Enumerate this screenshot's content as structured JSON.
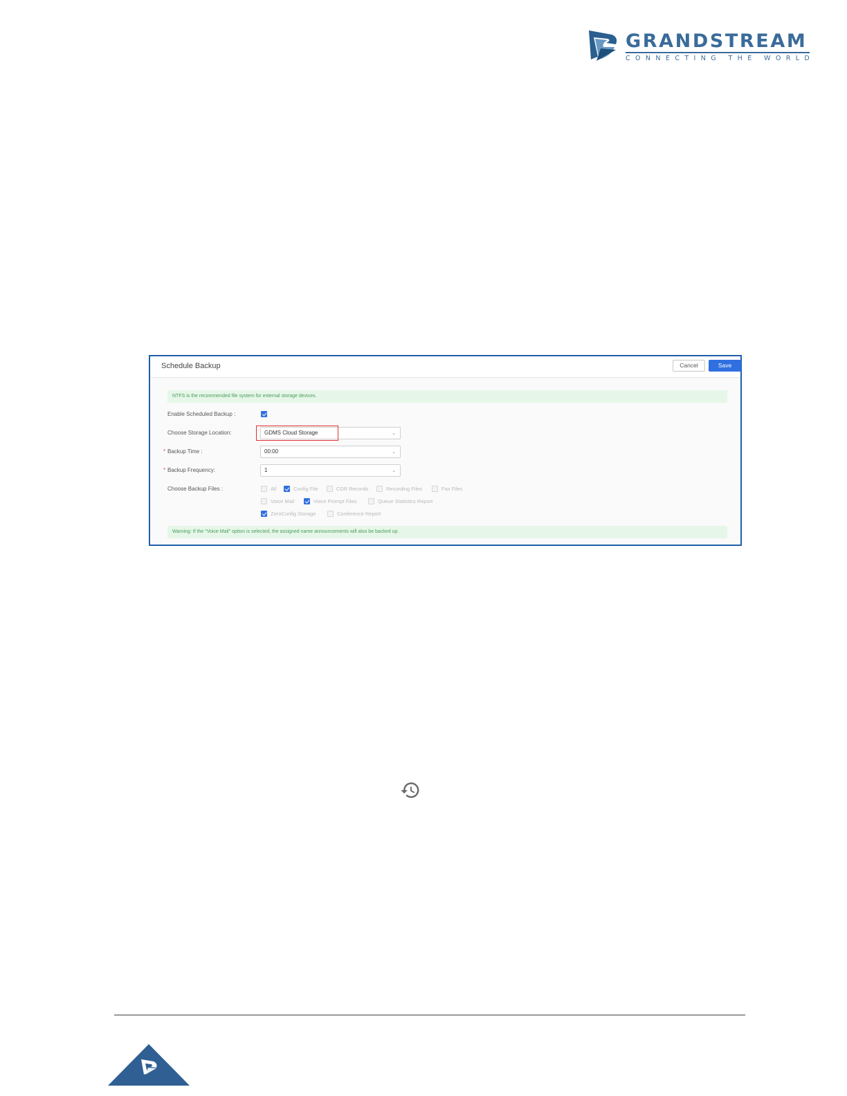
{
  "brand": {
    "name": "GRANDSTREAM",
    "tagline": "CONNECTING THE WORLD",
    "color": "#3a6b9a"
  },
  "dialog": {
    "title": "Schedule Backup",
    "cancel_label": "Cancel",
    "save_label": "Save",
    "notice_top": "NTFS is the recommended file system for external storage devices.",
    "notice_bottom": "Warning: If the \"Voice Mail\" option is selected, the assigned name announcements will also be backed up.",
    "fields": {
      "enable_label": "Enable Scheduled Backup :",
      "enable_checked": true,
      "storage_label": "Choose Storage Location:",
      "storage_value": "GDMS Cloud Storage",
      "time_label": "Backup Time :",
      "time_value": "00:00",
      "frequency_label": "Backup Frequency:",
      "frequency_value": "1",
      "files_label": "Choose Backup Files :"
    },
    "backup_files": [
      {
        "label": "All",
        "checked": false
      },
      {
        "label": "Config File",
        "checked": true
      },
      {
        "label": "CDR Records",
        "checked": false
      },
      {
        "label": "Recording Files",
        "checked": false
      },
      {
        "label": "Fax Files",
        "checked": false
      },
      {
        "label": "Voice Mail",
        "checked": false
      },
      {
        "label": "Voice Prompt Files",
        "checked": true
      },
      {
        "label": "Queue Statistics Report",
        "checked": false
      },
      {
        "label": "ZeroConfig Storage",
        "checked": true
      },
      {
        "label": "Conference Report",
        "checked": false
      }
    ],
    "accent": "#2f6fe0",
    "frame_color": "#1f5fa8",
    "highlight_color": "#e03030"
  },
  "icons": {
    "history": "history-icon",
    "footer": "grandstream-logo-icon"
  }
}
